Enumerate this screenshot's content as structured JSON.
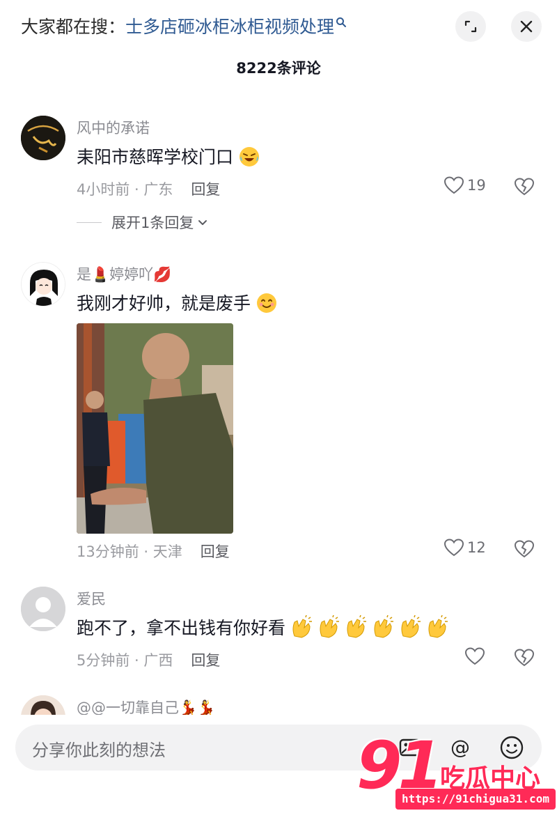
{
  "header": {
    "search_prefix": "大家都在搜：",
    "search_query": "士多店砸冰柜冰柜视频处理",
    "comment_count": "8222条评论"
  },
  "comments": [
    {
      "username": "风中的承诺",
      "text": "耒阳市慈晖学校门口",
      "emoji": "laughing-crying-emoji",
      "time_location": "4小时前 · 广东",
      "reply_label": "回复",
      "likes": "19",
      "expand_replies": "展开1条回复"
    },
    {
      "username": "是💄婷婷吖💋",
      "text": "我刚才好帅，就是废手",
      "emoji": "smiling-emoji",
      "time_location": "13分钟前 · 天津",
      "reply_label": "回复",
      "likes": "12"
    },
    {
      "username": "爱民",
      "text": "跑不了，拿不出钱有你好看",
      "emoji": "clapping-hands-emoji",
      "time_location": "5分钟前 · 广西",
      "reply_label": "回复",
      "likes": ""
    },
    {
      "username": "@@一切靠自己💃💃"
    }
  ],
  "input": {
    "placeholder": "分享你此刻的想法"
  },
  "watermark": {
    "number": "91",
    "chinese": "吃瓜中心",
    "url": "https://91chigua31.com"
  },
  "colors": {
    "accent_blue": "#2f5a92",
    "watermark_red": "#ff2a57",
    "text_primary": "#161823",
    "text_secondary": "#8a8b91"
  }
}
